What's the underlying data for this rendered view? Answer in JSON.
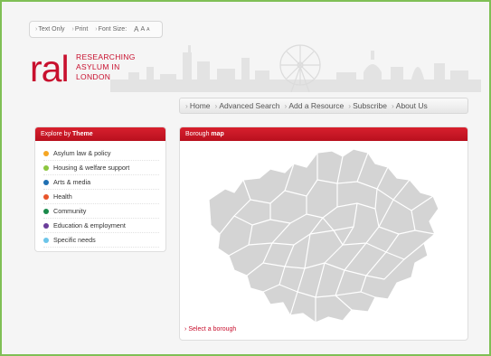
{
  "utility_bar": {
    "text_only": "Text Only",
    "print": "Print",
    "font_size_label": "Font Size:",
    "font_options": [
      "A",
      "A",
      "A"
    ]
  },
  "logo": {
    "mark": "ral",
    "lines": [
      "RESEARCHING",
      "ASYLUM IN",
      "LONDON"
    ]
  },
  "nav": {
    "items": [
      "Home",
      "Advanced Search",
      "Add a Resource",
      "Subscribe",
      "About Us"
    ]
  },
  "theme_panel": {
    "title_prefix": "Explore by",
    "title_bold": "Theme",
    "items": [
      {
        "label": "Asylum law & policy",
        "color": "#f5a623"
      },
      {
        "label": "Housing & welfare support",
        "color": "#8cc63f"
      },
      {
        "label": "Arts & media",
        "color": "#1f6fb2"
      },
      {
        "label": "Health",
        "color": "#e8542b"
      },
      {
        "label": "Community",
        "color": "#1a8a4a"
      },
      {
        "label": "Education & employment",
        "color": "#6a3d9a"
      },
      {
        "label": "Specific needs",
        "color": "#6cc5e9"
      }
    ]
  },
  "map_panel": {
    "title_prefix": "Borough",
    "title_bold": "map",
    "select_link": "Select a borough"
  },
  "colors": {
    "accent": "#c8102e",
    "frame_border": "#7fbf55",
    "map_fill": "#d4d4d4"
  }
}
